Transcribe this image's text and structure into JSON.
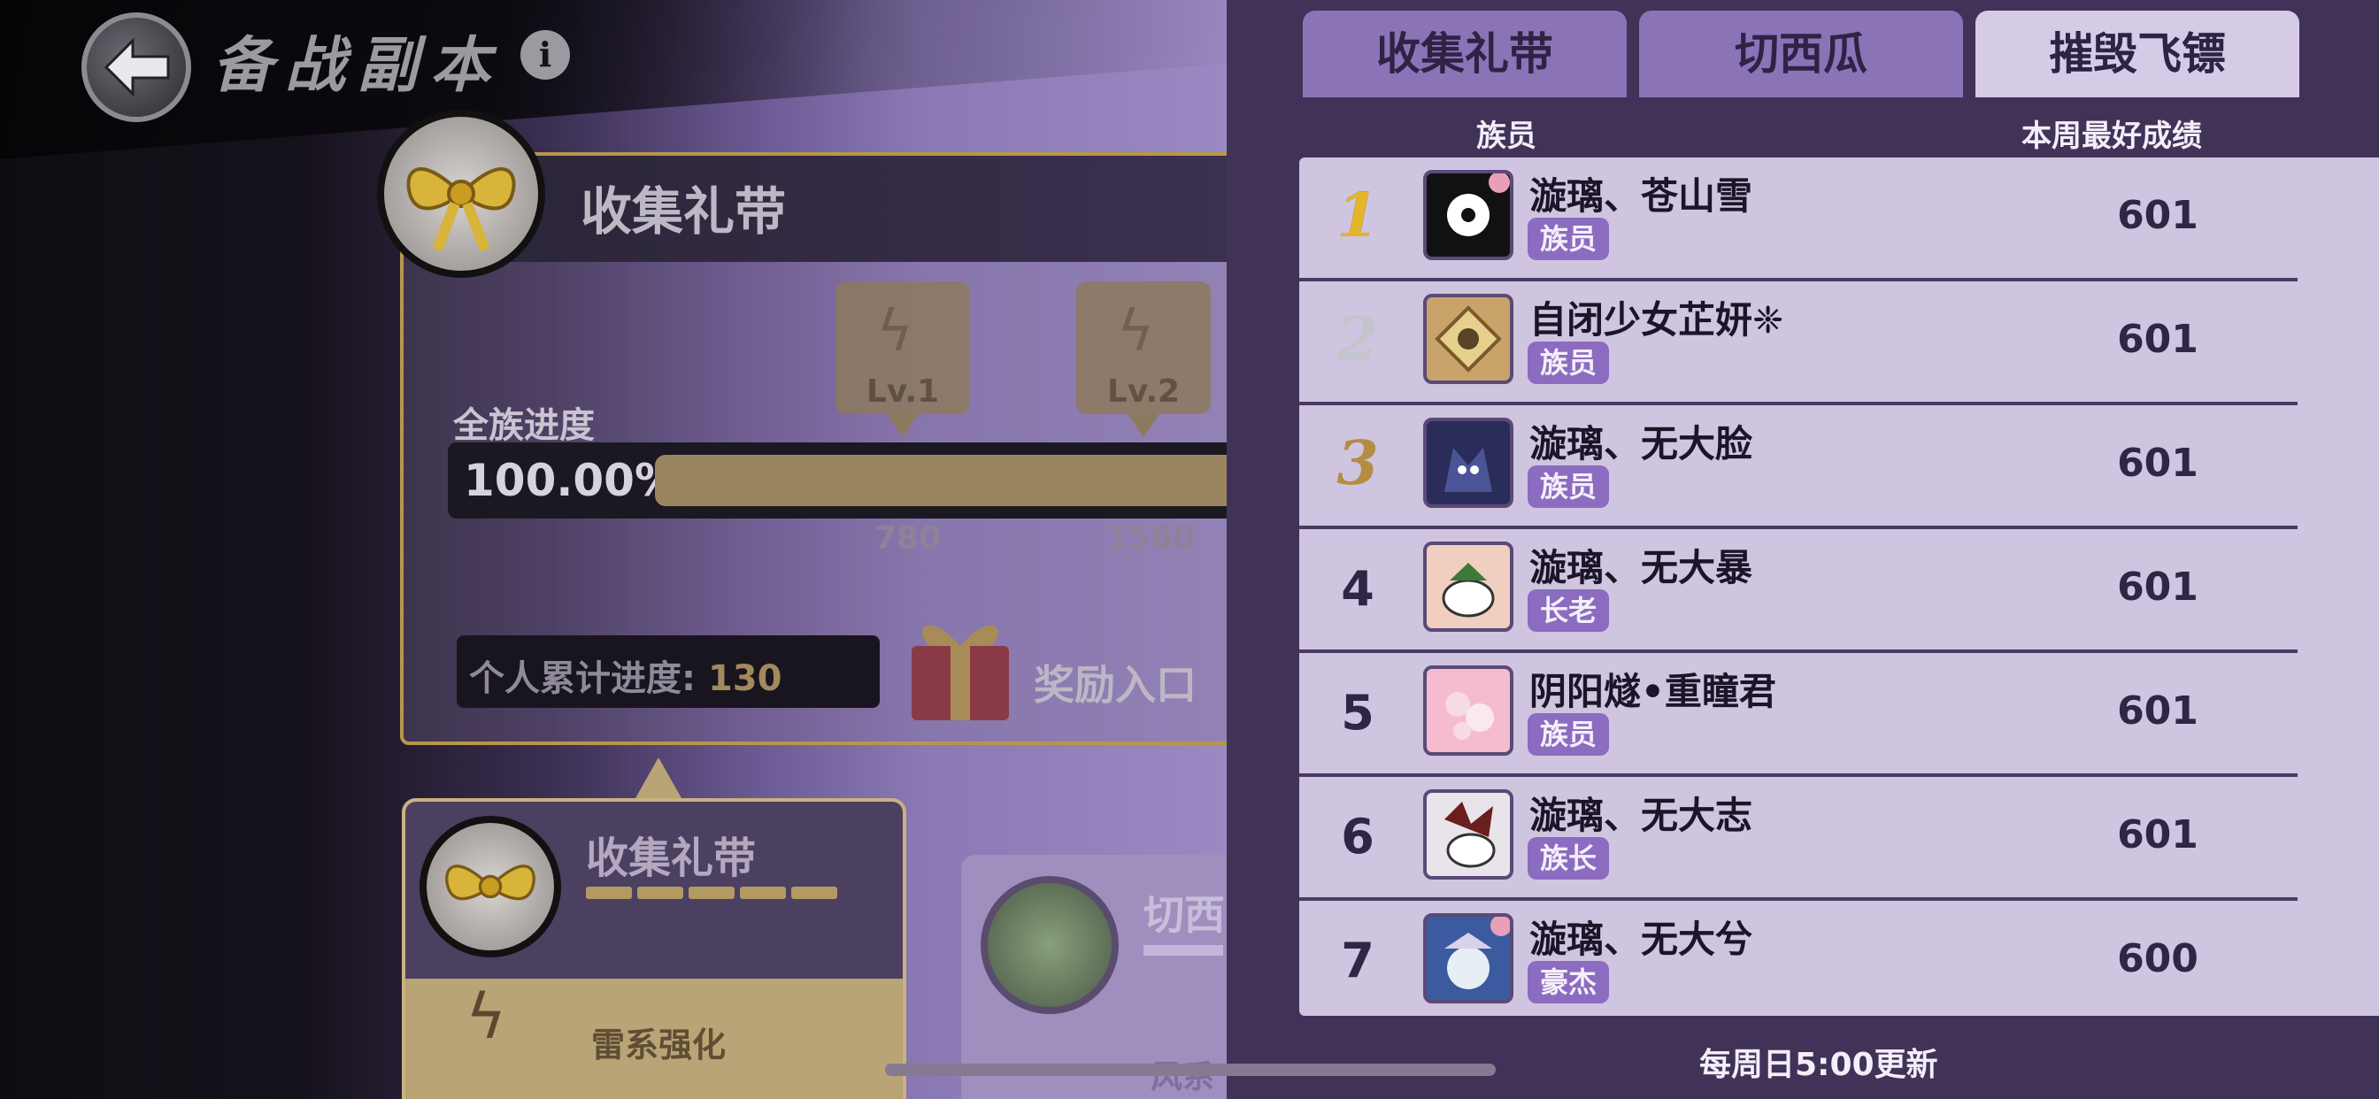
{
  "left": {
    "title": "备战副本",
    "panel": {
      "title": "收集礼带",
      "progress_label": "全族进度",
      "progress_pct": "100.00%",
      "progress_fraction": 1.0,
      "levels": [
        {
          "label": "Lv.1",
          "value": "780"
        },
        {
          "label": "Lv.2",
          "value": "1560"
        }
      ],
      "personal_label": "个人累计进度:",
      "personal_value": "130",
      "reward_label": "奖励入口"
    },
    "cards": [
      {
        "title": "收集礼带",
        "buff": "雷系强化"
      },
      {
        "title": "切西",
        "buff": "风系"
      }
    ]
  },
  "tabs": [
    {
      "label": "收集礼带",
      "active": false
    },
    {
      "label": "切西瓜",
      "active": false
    },
    {
      "label": "摧毁飞镖",
      "active": true
    }
  ],
  "table": {
    "col_member": "族员",
    "col_score": "本周最好成绩",
    "rows": [
      {
        "rank": "1",
        "name": "漩璃、苍山雪",
        "role": "族员",
        "score": "601"
      },
      {
        "rank": "2",
        "name": "自闭少女芷妍❈",
        "role": "族员",
        "score": "601"
      },
      {
        "rank": "3",
        "name": "漩璃、无大脸",
        "role": "族员",
        "score": "601"
      },
      {
        "rank": "4",
        "name": "漩璃、无大暴",
        "role": "长老",
        "score": "601"
      },
      {
        "rank": "5",
        "name": "阴阳燧•重瞳君",
        "role": "族员",
        "score": "601"
      },
      {
        "rank": "6",
        "name": "漩璃、无大志",
        "role": "族长",
        "score": "601"
      },
      {
        "rank": "7",
        "name": "漩璃、无大兮",
        "role": "豪杰",
        "score": "600"
      }
    ]
  },
  "footer": "每周日5:00更新",
  "colors": {
    "accent_gold": "#e3b52a",
    "role_badge": "#8b6cc0",
    "panel_bg": "#413258",
    "list_bg": "#cfc5e0"
  }
}
